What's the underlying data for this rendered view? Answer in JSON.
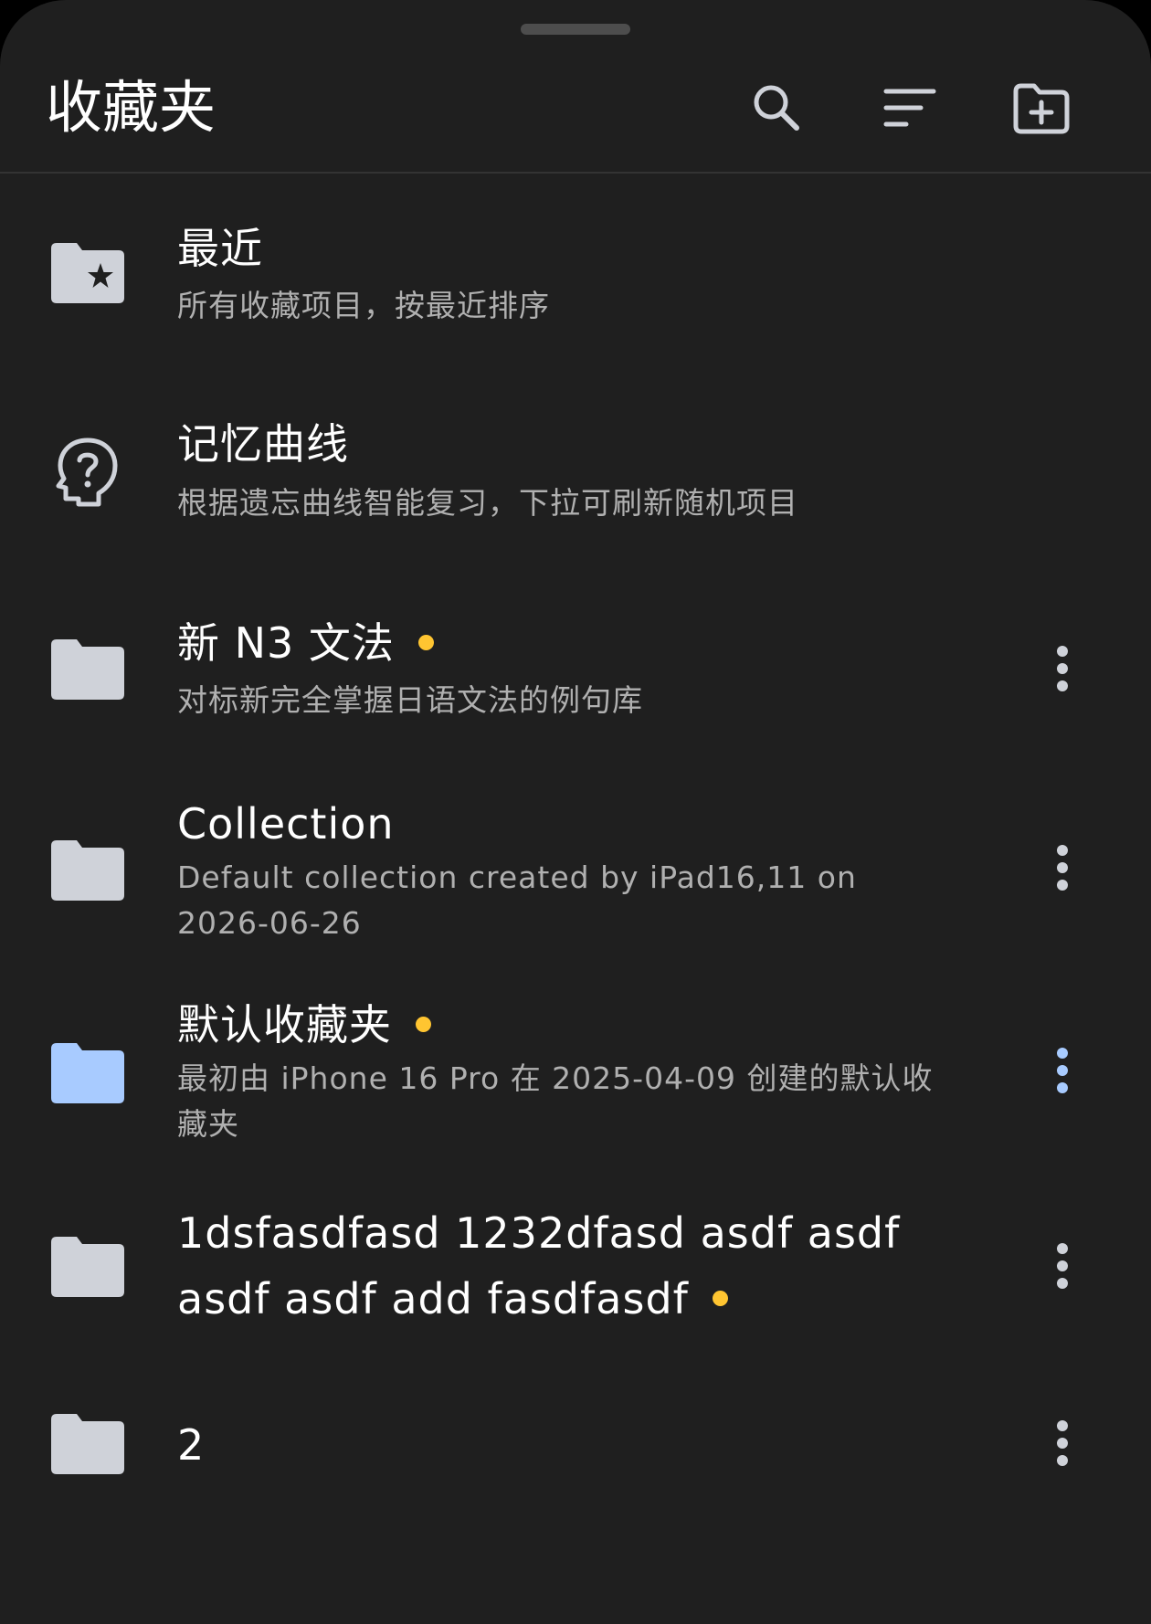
{
  "colors": {
    "background": "#1f1f1f",
    "text_primary": "#ffffff",
    "text_secondary": "#b0b0b0",
    "icon_default": "#cfd2d9",
    "accent_blue": "#a8cbff",
    "dot_yellow": "#ffc531"
  },
  "header": {
    "title": "收藏夹",
    "actions": [
      "search-icon",
      "sort-icon",
      "new-folder-icon"
    ]
  },
  "items": [
    {
      "title": "最近",
      "subtitle": "所有收藏项目，按最近排序",
      "icon": "folder-star-icon",
      "has_dot": false,
      "has_menu": false
    },
    {
      "title": "记忆曲线",
      "subtitle": "根据遗忘曲线智能复习，下拉可刷新随机项目",
      "icon": "head-question-icon",
      "has_dot": false,
      "has_menu": false
    },
    {
      "title": "新 N3 文法",
      "subtitle": "对标新完全掌握日语文法的例句库",
      "icon": "folder-icon",
      "has_dot": true,
      "has_menu": true
    },
    {
      "title": "Collection",
      "subtitle": "Default collection created by iPad16,11 on 2026-06-26",
      "icon": "folder-icon",
      "has_dot": false,
      "has_menu": true
    },
    {
      "title": "默认收藏夹",
      "subtitle": "最初由 iPhone 16 Pro 在 2025-04-09 创建的默认收藏夹",
      "icon": "folder-icon",
      "selected": true,
      "has_dot": true,
      "has_menu": true
    },
    {
      "title": "1dsfasdfasd 1232dfasd asdf asdf asdf asdf add fasdfasdf",
      "subtitle": "",
      "icon": "folder-icon",
      "has_dot": true,
      "has_menu": true
    },
    {
      "title": "2",
      "subtitle": "",
      "icon": "folder-icon",
      "has_dot": false,
      "has_menu": true
    }
  ]
}
